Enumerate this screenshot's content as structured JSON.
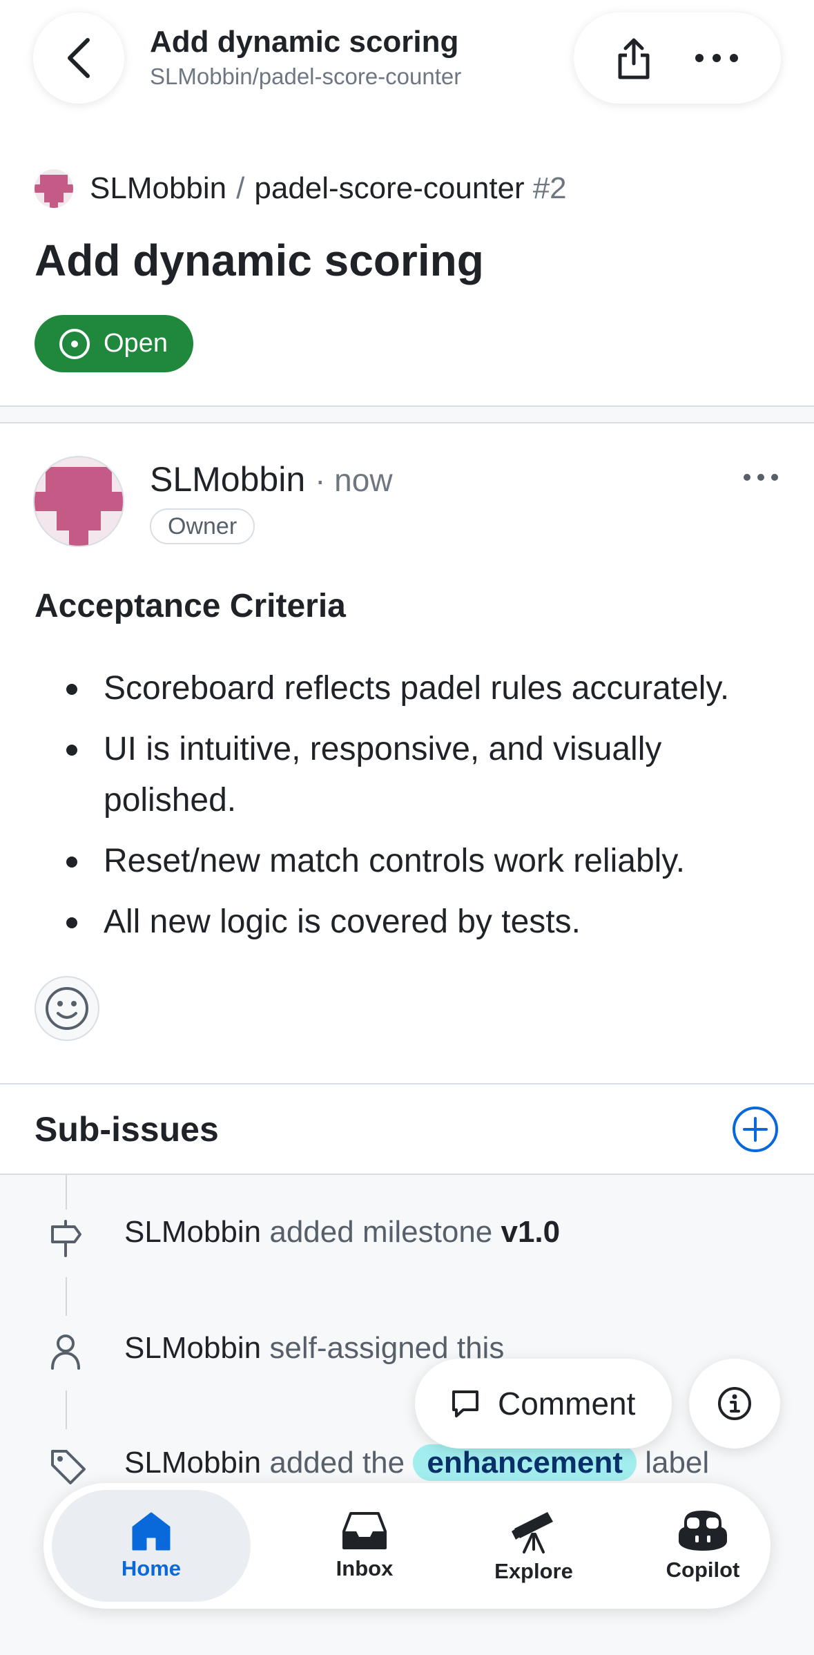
{
  "header": {
    "title": "Add dynamic scoring",
    "subtitle": "SLMobbin/padel-score-counter"
  },
  "repo": {
    "owner": "SLMobbin",
    "separator": "/",
    "name": "padel-score-counter",
    "issue_number": "#2"
  },
  "issue": {
    "title": "Add dynamic scoring",
    "state": "Open"
  },
  "comment": {
    "author": "SLMobbin",
    "time": "· now",
    "role": "Owner",
    "heading": "Acceptance Criteria",
    "criteria": [
      "Scoreboard reflects padel rules accurately.",
      "UI is intuitive, responsive, and visually polished.",
      "Reset/new match controls work reliably.",
      "All new logic is covered by tests."
    ]
  },
  "sub_issues": {
    "title": "Sub-issues"
  },
  "timeline": [
    {
      "icon": "milestone-icon",
      "actor": "SLMobbin",
      "action": " added milestone ",
      "target": "v1.0"
    },
    {
      "icon": "person-icon",
      "actor": "SLMobbin",
      "action": " self-assigned this"
    },
    {
      "icon": "tag-icon",
      "actor": "SLMobbin",
      "action": " added the ",
      "label": "enhancement",
      "suffix": " label"
    }
  ],
  "fab": {
    "comment_label": "Comment"
  },
  "tabs": [
    {
      "label": "Home",
      "icon": "home-icon",
      "active": true
    },
    {
      "label": "Inbox",
      "icon": "inbox-icon",
      "active": false
    },
    {
      "label": "Explore",
      "icon": "telescope-icon",
      "active": false
    },
    {
      "label": "Copilot",
      "icon": "copilot-icon",
      "active": false
    }
  ],
  "colors": {
    "open_green": "#1f883d",
    "accent_blue": "#0969da",
    "label_bg": "#a2eeef",
    "avatar_pink": "#c45b86"
  }
}
